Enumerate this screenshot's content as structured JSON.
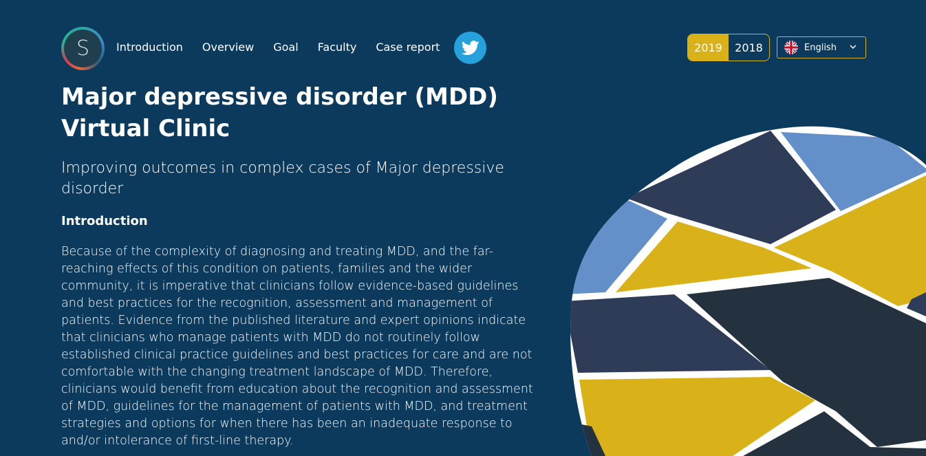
{
  "nav": {
    "logo_letter": "S",
    "links": [
      "Introduction",
      "Overview",
      "Goal",
      "Faculty",
      "Case report"
    ]
  },
  "years": [
    "2019",
    "2018"
  ],
  "selected_year": "2019",
  "language": {
    "selected": "English"
  },
  "hero": {
    "title_line1": "Major depressive disorder (MDD)",
    "title_line2": "Virtual Clinic",
    "subtitle": "Improving outcomes in complex cases of Major depressive disorder"
  },
  "intro": {
    "heading": "Introduction",
    "body": "Because of the complexity of diagnosing and treating MDD, and the far-reaching effects of this condition on patients, families and the wider community, it is imperative that clinicians follow evidence-based guidelines and best practices for the recognition, assessment and management of patients. Evidence from the published literature and expert opinions indicate that clinicians who manage patients with MDD do not routinely follow established clinical practice guidelines and best practices for care and are not comfortable with the changing treatment landscape of MDD. Therefore, clinicians would benefit from education about the recognition and assessment of MDD, guidelines for the management of patients with MDD, and treatment strategies and options for when there has been an inadequate response to and/or intolerance of first-line therapy."
  },
  "colors": {
    "background": "#0c3a5c",
    "accent": "#d9b21a",
    "twitter": "#27a1db",
    "mosaic_blue": "#6390c8",
    "mosaic_navy": "#2e3c58",
    "mosaic_dark": "#23323e",
    "mosaic_yellow": "#d9b21a"
  },
  "icons": {
    "twitter": "twitter-bird-icon",
    "flag": "uk-flag-icon",
    "dropdown": "chevron-down-icon"
  }
}
